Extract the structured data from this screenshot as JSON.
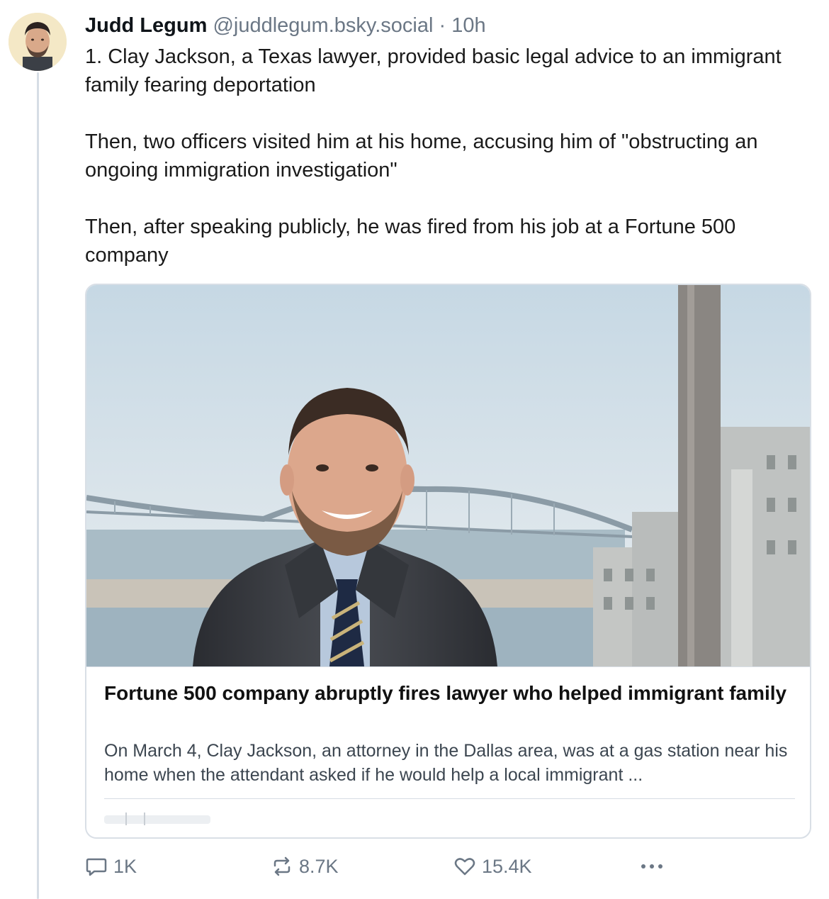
{
  "post": {
    "author_name": "Judd Legum",
    "handle": "@juddlegum.bsky.social",
    "separator": "·",
    "time": "10h",
    "paragraphs": [
      "1. Clay Jackson, a Texas lawyer, provided basic legal advice to an immigrant family fearing deportation",
      "Then, two officers visited him at his home, accusing him of \"obstructing an ongoing immigration investigation\"",
      "Then, after speaking publicly, he was fired from his job at a Fortune 500 company"
    ]
  },
  "card": {
    "title": "Fortune 500 company abruptly fires lawyer who helped immigrant family",
    "description": "On March 4, Clay Jackson, an attorney in the Dallas area, was at a gas station near his home when the attendant asked if he would help a local immigrant ..."
  },
  "actions": {
    "replies": "1K",
    "reposts": "8.7K",
    "likes": "15.4K"
  },
  "icons": {
    "reply": "speech-bubble-icon",
    "repost": "repost-arrows-icon",
    "like": "heart-icon",
    "more": "more-dots-icon"
  },
  "colors": {
    "muted_text": "#6b7785",
    "border": "#d9dfe6",
    "thread_line": "#d6dde5"
  }
}
